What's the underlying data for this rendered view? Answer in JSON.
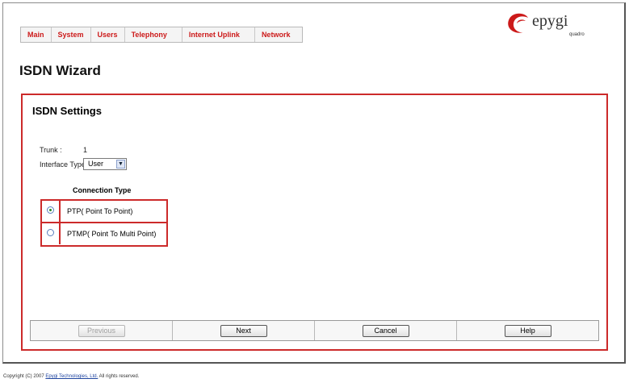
{
  "menu": [
    "Main",
    "System",
    "Users",
    "Telephony",
    "Internet Uplink",
    "Network"
  ],
  "logo": {
    "text": "epygi",
    "sub": "quadro"
  },
  "page_title": "ISDN Wizard",
  "section_title": "ISDN Settings",
  "trunk": {
    "label": "Trunk :",
    "value": "1"
  },
  "interface_type": {
    "label": "Interface Type",
    "value": "User"
  },
  "connection": {
    "title": "Connection Type",
    "options": [
      {
        "label": "PTP( Point To Point)",
        "selected": true
      },
      {
        "label": "PTMP( Point To Multi Point)",
        "selected": false
      }
    ]
  },
  "buttons": {
    "previous": "Previous",
    "next": "Next",
    "cancel": "Cancel",
    "help": "Help"
  },
  "footer": {
    "prefix": "Copyright (C) 2007",
    "company": "Epygi Technologies, Ltd.",
    "suffix": "All rights reserved."
  },
  "colors": {
    "accent": "#cc2a2a",
    "menu_text": "#cc1a1a"
  }
}
